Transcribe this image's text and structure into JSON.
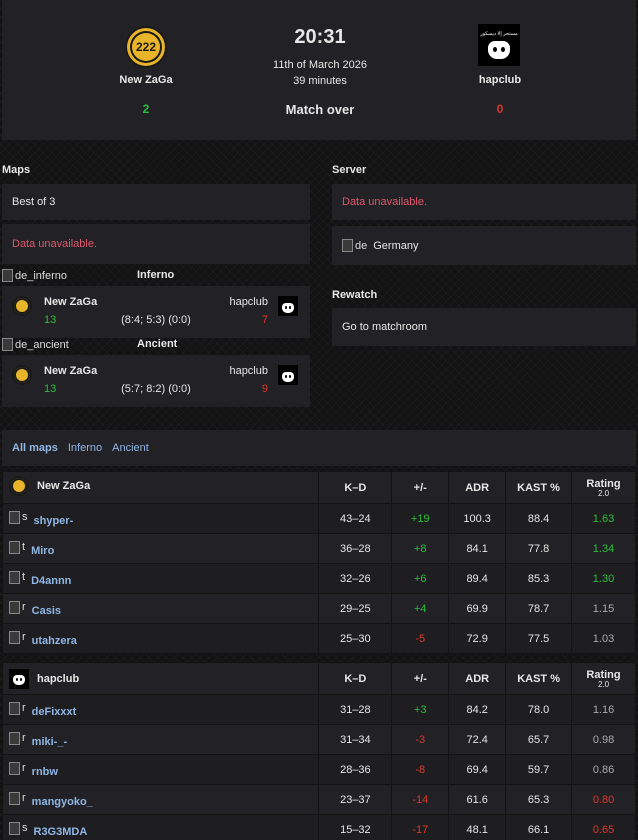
{
  "match": {
    "time": "20:31",
    "date": "11th of March 2026",
    "duration": "39 minutes",
    "status": "Match over",
    "team1": {
      "name": "New ZaGa",
      "score": "2",
      "logo_text": "222"
    },
    "team2": {
      "name": "hapclub",
      "score": "0",
      "logo_text": "مستحر إلا ديسكور"
    }
  },
  "maps_section": {
    "label": "Maps",
    "format": "Best of 3",
    "veto_text": "Data unavailable.",
    "maps": [
      {
        "img_alt": "de_inferno",
        "name": "Inferno",
        "team1": "New ZaGa",
        "team1_score": "13",
        "team2": "hapclub",
        "team2_score": "7",
        "halves": "(8:4; 5:3) (0:0)"
      },
      {
        "img_alt": "de_ancient",
        "name": "Ancient",
        "team1": "New ZaGa",
        "team1_score": "13",
        "team2": "hapclub",
        "team2_score": "9",
        "halves": "(5:7; 8:2) (0:0)"
      }
    ]
  },
  "server_section": {
    "label": "Server",
    "info_text": "Data unavailable.",
    "flag_alt": "de",
    "location": "Germany"
  },
  "rewatch_section": {
    "label": "Rewatch",
    "link": "Go to matchroom"
  },
  "stats_tabs": [
    "All maps",
    "Inferno",
    "Ancient"
  ],
  "stats_headers": {
    "kd": "K–D",
    "plusminus": "+/-",
    "adr": "ADR",
    "kast": "KAST %",
    "rating": "Rating",
    "rating_version": "2.0"
  },
  "team1_stats": {
    "team": "New ZaGa",
    "players": [
      {
        "img": "s",
        "name": "shyper-",
        "kd": "43–24",
        "pm": "+19",
        "adr": "100.3",
        "kast": "88.4",
        "rating": "1.63"
      },
      {
        "img": "t",
        "name": "Miro",
        "kd": "36–28",
        "pm": "+8",
        "adr": "84.1",
        "kast": "77.8",
        "rating": "1.34"
      },
      {
        "img": "t",
        "name": "D4annn",
        "kd": "32–26",
        "pm": "+6",
        "adr": "89.4",
        "kast": "85.3",
        "rating": "1.30"
      },
      {
        "img": "r",
        "name": "Casis",
        "kd": "29–25",
        "pm": "+4",
        "adr": "69.9",
        "kast": "78.7",
        "rating": "1.15"
      },
      {
        "img": "r",
        "name": "utahzera",
        "kd": "25–30",
        "pm": "-5",
        "adr": "72.9",
        "kast": "77.5",
        "rating": "1.03"
      }
    ]
  },
  "team2_stats": {
    "team": "hapclub",
    "players": [
      {
        "img": "r",
        "name": "deFixxxt",
        "kd": "31–28",
        "pm": "+3",
        "adr": "84.2",
        "kast": "78.0",
        "rating": "1.16"
      },
      {
        "img": "r",
        "name": "miki-_-",
        "kd": "31–34",
        "pm": "-3",
        "adr": "72.4",
        "kast": "65.7",
        "rating": "0.98"
      },
      {
        "img": "r",
        "name": "rnbw",
        "kd": "28–36",
        "pm": "-8",
        "adr": "69.4",
        "kast": "59.7",
        "rating": "0.86"
      },
      {
        "img": "r",
        "name": "mangyoko_",
        "kd": "23–37",
        "pm": "-14",
        "adr": "61.6",
        "kast": "65.3",
        "rating": "0.80"
      },
      {
        "img": "s",
        "name": "R3G3MDA",
        "kd": "15–32",
        "pm": "-17",
        "adr": "48.1",
        "kast": "66.1",
        "rating": "0.65"
      }
    ]
  },
  "colors": {
    "positive": "#2bbf3a",
    "negative": "#e0352b",
    "neutral": "#aaaaaa",
    "link": "#8fb6e4"
  }
}
